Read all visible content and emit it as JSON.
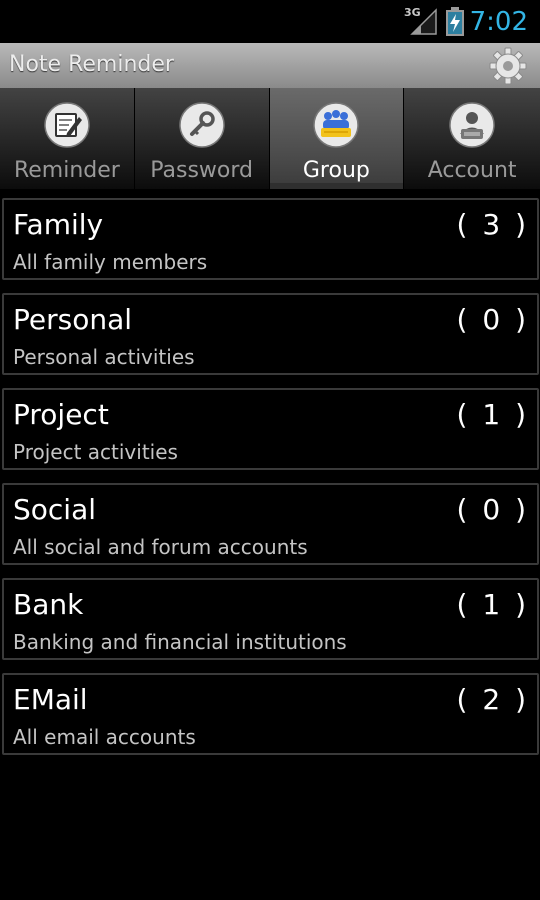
{
  "status_bar": {
    "network": "3G",
    "time": "7:02",
    "colors": {
      "accent": "#33b5e5"
    }
  },
  "app": {
    "title": "Note Reminder",
    "settings_icon": "gear-icon"
  },
  "tabs": [
    {
      "label": "Reminder",
      "icon": "note-edit-icon",
      "selected": false
    },
    {
      "label": "Password",
      "icon": "key-icon",
      "selected": false
    },
    {
      "label": "Group",
      "icon": "group-people-icon",
      "selected": true
    },
    {
      "label": "Account",
      "icon": "account-lock-icon",
      "selected": false
    }
  ],
  "groups": [
    {
      "name": "Family",
      "count": "( 3 )",
      "description": "All family members"
    },
    {
      "name": "Personal",
      "count": "( 0 )",
      "description": "Personal activities"
    },
    {
      "name": "Project",
      "count": "( 1 )",
      "description": "Project activities"
    },
    {
      "name": "Social",
      "count": "( 0 )",
      "description": "All social and forum accounts"
    },
    {
      "name": "Bank",
      "count": "( 1 )",
      "description": "Banking and financial institutions"
    },
    {
      "name": "EMail",
      "count": "( 2 )",
      "description": "All email accounts"
    }
  ]
}
